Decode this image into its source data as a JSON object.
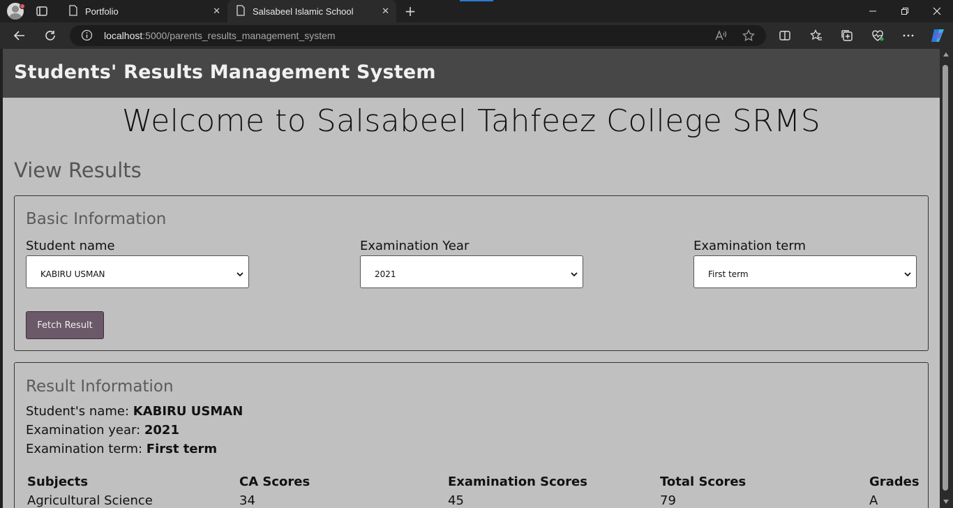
{
  "browser": {
    "tabs": [
      {
        "title": "Portfolio"
      },
      {
        "title": "Salsabeel Islamic School"
      }
    ],
    "url_host": "localhost",
    "url_rest": ":5000/parents_results_management_system"
  },
  "page": {
    "app_title": "Students' Results Management System",
    "welcome": "Welcome to Salsabeel Tahfeez College SRMS",
    "section_title": "View Results",
    "basic_info": {
      "heading": "Basic Information",
      "student_label": "Student name",
      "student_value": "KABIRU USMAN",
      "year_label": "Examination Year",
      "year_value": "2021",
      "term_label": "Examination term",
      "term_value": "First term",
      "fetch_button": "Fetch Result"
    },
    "result_info": {
      "heading": "Result Information",
      "name_label": "Student's name:",
      "name_value": "KABIRU USMAN",
      "year_label": "Examination year:",
      "year_value": "2021",
      "term_label": "Examination term:",
      "term_value": "First term",
      "columns": [
        "Subjects",
        "CA Scores",
        "Examination Scores",
        "Total Scores",
        "Grades"
      ],
      "rows": [
        [
          "Agricultural Science",
          "34",
          "45",
          "79",
          "A"
        ]
      ]
    }
  },
  "colors": {
    "header_bg": "#474747",
    "page_bg": "#c0c0c0",
    "button_bg": "#6b5868"
  }
}
